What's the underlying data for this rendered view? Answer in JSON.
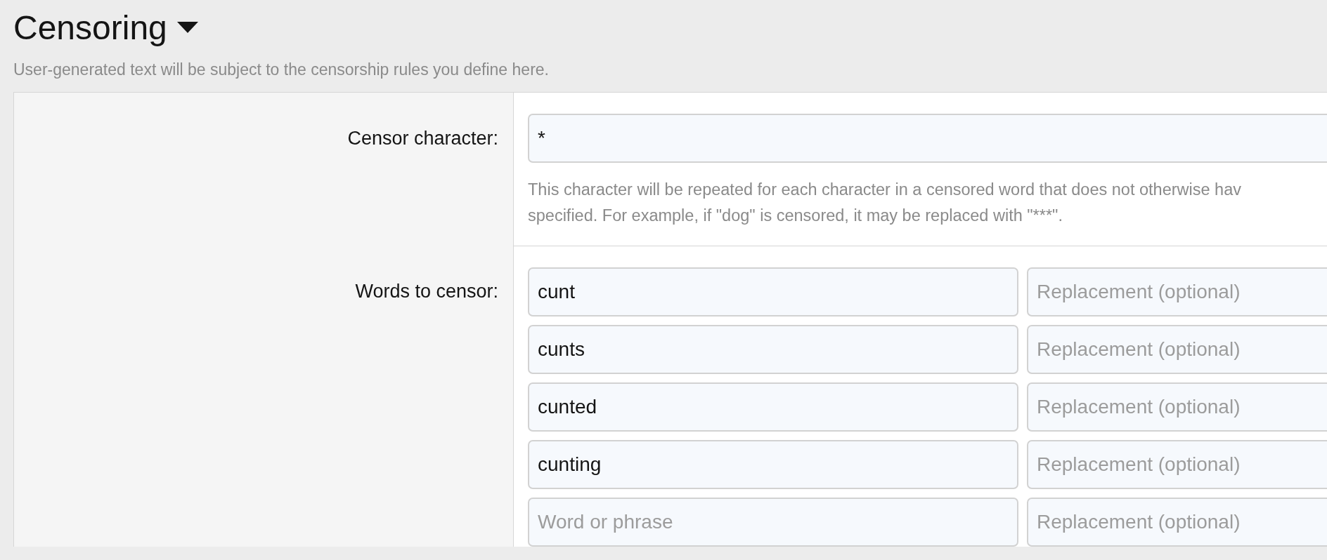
{
  "header": {
    "title": "Censoring",
    "description": "User-generated text will be subject to the censorship rules you define here."
  },
  "censor_character": {
    "label": "Censor character:",
    "value": "*",
    "help": [
      "This character will be repeated for each character in a censored word that does not otherwise hav",
      "specified. For example, if \"dog\" is censored, it may be replaced with \"***\"."
    ]
  },
  "words_to_censor": {
    "label": "Words to censor:",
    "rows": [
      {
        "word": "cunt",
        "replacement_placeholder": "Replacement (optional)"
      },
      {
        "word": "cunts",
        "replacement_placeholder": "Replacement (optional)"
      },
      {
        "word": "cunted",
        "replacement_placeholder": "Replacement (optional)"
      },
      {
        "word": "cunting",
        "replacement_placeholder": "Replacement (optional)"
      },
      {
        "word_placeholder": "Word or phrase",
        "replacement_placeholder": "Replacement (optional)"
      }
    ]
  }
}
